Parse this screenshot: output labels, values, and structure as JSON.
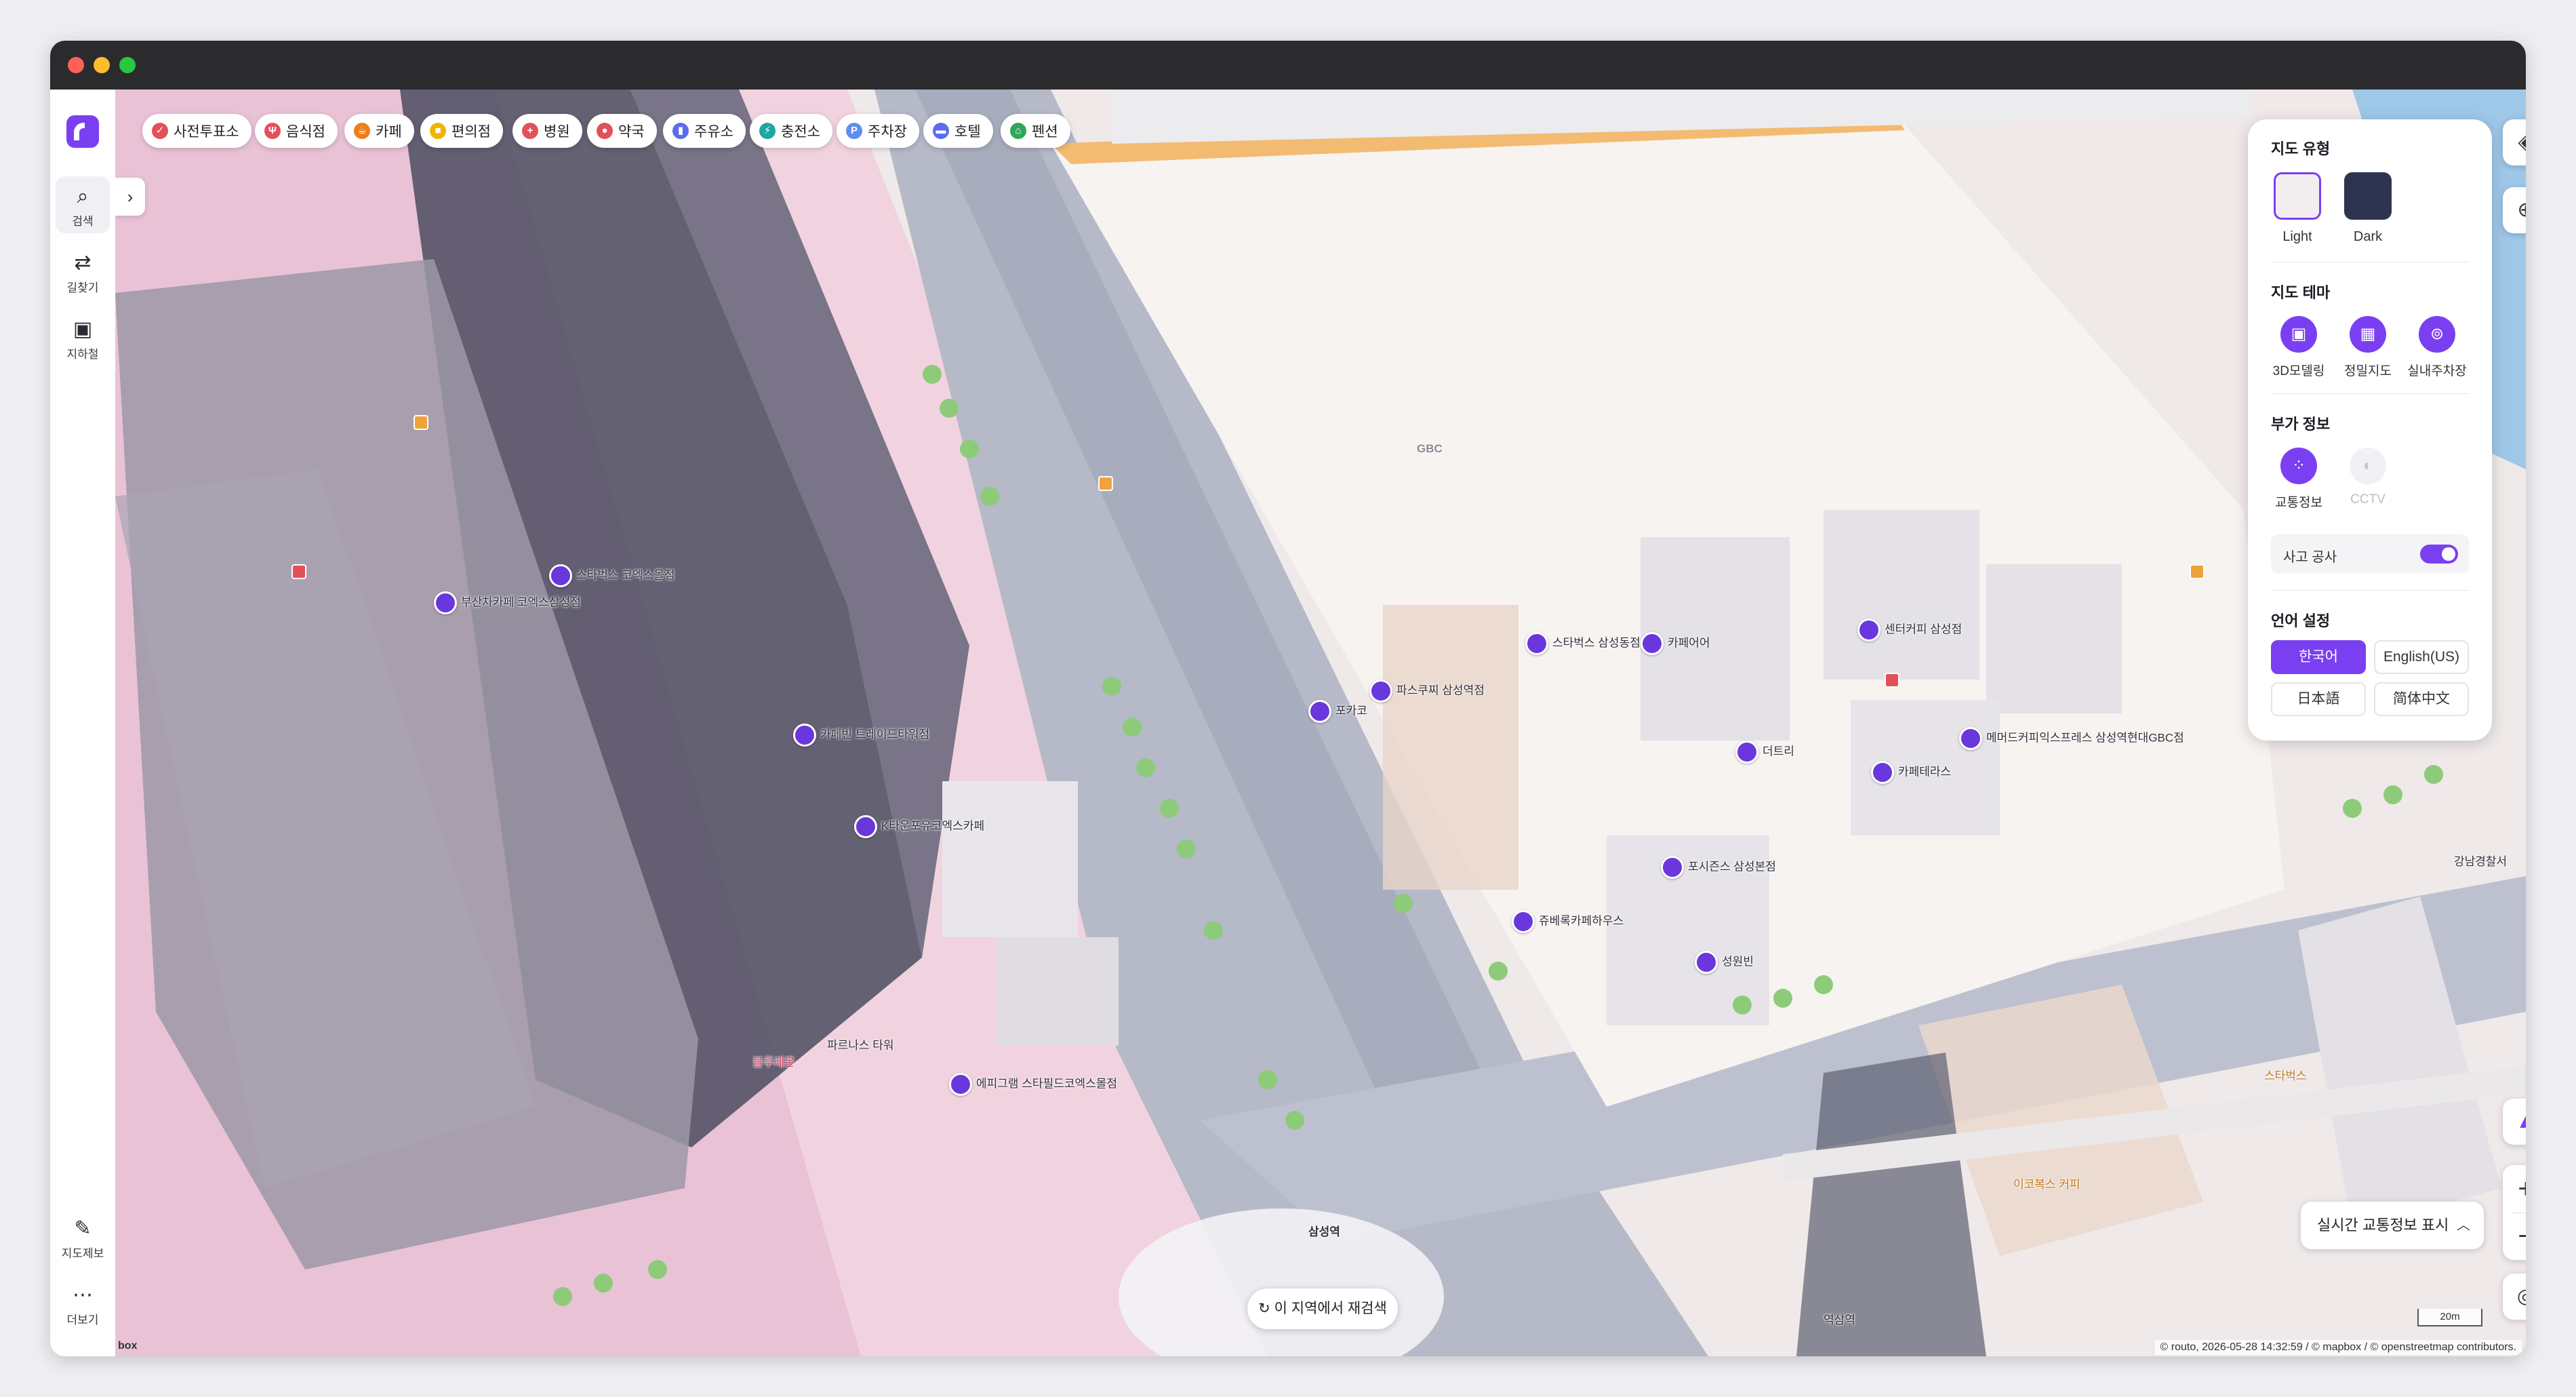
{
  "sidebar": {
    "items": [
      {
        "label": "검색",
        "icon": "search-icon"
      },
      {
        "label": "길찾기",
        "icon": "route-icon"
      },
      {
        "label": "지하철",
        "icon": "subway-icon"
      }
    ],
    "bottom": [
      {
        "label": "지도제보",
        "icon": "edit-icon"
      },
      {
        "label": "더보기",
        "icon": "more-icon"
      }
    ]
  },
  "categories": [
    {
      "label": "사전투표소",
      "color": "#e2505a",
      "glyph": "✓"
    },
    {
      "label": "음식점",
      "color": "#e2505a",
      "glyph": "Ψ"
    },
    {
      "label": "카페",
      "color": "#f07c1e",
      "glyph": "☕"
    },
    {
      "label": "편의점",
      "color": "#f0b400",
      "glyph": "■"
    },
    {
      "label": "병원",
      "color": "#e2505a",
      "glyph": "+"
    },
    {
      "label": "약국",
      "color": "#e2505a",
      "glyph": "●"
    },
    {
      "label": "주유소",
      "color": "#5b6cf0",
      "glyph": "▮"
    },
    {
      "label": "충전소",
      "color": "#1fa6a0",
      "glyph": "⚡"
    },
    {
      "label": "주차장",
      "color": "#5b8ef0",
      "glyph": "P"
    },
    {
      "label": "호텔",
      "color": "#5b6cf0",
      "glyph": "▬"
    },
    {
      "label": "펜션",
      "color": "#2fa65a",
      "glyph": "⌂"
    }
  ],
  "panel": {
    "map_type_title": "지도 유형",
    "map_types": [
      {
        "label": "Light"
      },
      {
        "label": "Dark"
      }
    ],
    "theme_title": "지도 테마",
    "themes": [
      {
        "label": "3D모델링"
      },
      {
        "label": "정밀지도"
      },
      {
        "label": "실내주차장"
      }
    ],
    "extra_title": "부가 정보",
    "extras": [
      {
        "label": "교통정보",
        "active": true
      },
      {
        "label": "CCTV",
        "active": false
      }
    ],
    "toggle_label": "사고 공사",
    "lang_title": "언어 설정",
    "langs": [
      {
        "label": "한국어",
        "active": true
      },
      {
        "label": "English(US)"
      },
      {
        "label": "日本語"
      },
      {
        "label": "简体中文"
      }
    ]
  },
  "controls": {
    "traffic_label": "실시간 교통정보 표시",
    "research_label": "이 지역에서 재검색",
    "scale_label": "20m",
    "attribution": "© routo, 2026-05-28 14:32:59 / © mapbox / © openstreetmap contributors.",
    "mapbox_label": "box"
  },
  "pois": [
    {
      "label": "부산차카페 코엑스삼성점",
      "purple": true
    },
    {
      "label": "스타벅스 코엑스몰점",
      "purple": true
    },
    {
      "label": "카페빈 트레이드타워점",
      "purple": true
    },
    {
      "label": "K타운포유코엑스카페",
      "purple": true
    },
    {
      "label": "에피그램 스타필드코엑스몰점",
      "purple": true
    },
    {
      "label": "파스쿠찌 삼성역점",
      "purple": true
    },
    {
      "label": "스타벅스 삼성동점",
      "purple": true
    },
    {
      "label": "카페어어",
      "purple": true
    },
    {
      "label": "센터커피 삼성점",
      "purple": true
    },
    {
      "label": "메머드커피익스프레스 삼성역현대GBC점",
      "purple": true
    },
    {
      "label": "더트리",
      "purple": true
    },
    {
      "label": "카페테라스",
      "purple": true
    },
    {
      "label": "포시즌스 삼성본점",
      "purple": true
    },
    {
      "label": "쥬베록카페하우스",
      "purple": true
    },
    {
      "label": "성원빈",
      "purple": true
    },
    {
      "label": "포카코",
      "purple": true
    },
    {
      "label": "블루레몬",
      "purple": false
    },
    {
      "label": "파르나스 타워",
      "purple": false
    },
    {
      "label": "삼성역",
      "purple": false
    },
    {
      "label": "강남경찰서",
      "purple": false
    },
    {
      "label": "스타벅스",
      "purple": false
    },
    {
      "label": "이코복스 커피",
      "purple": false
    },
    {
      "label": "역삼역",
      "purple": false
    },
    {
      "label": "GBC",
      "purple": false
    }
  ]
}
